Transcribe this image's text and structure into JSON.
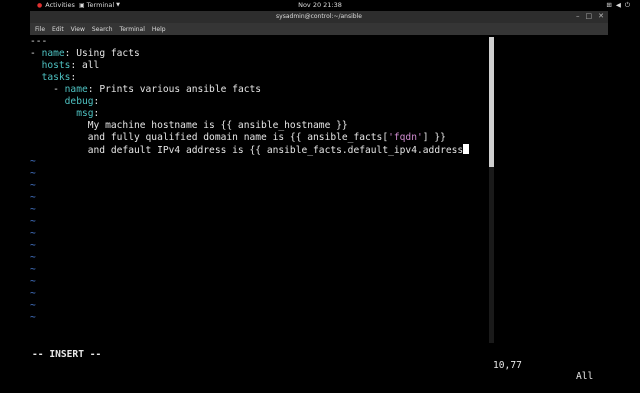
{
  "topbar": {
    "activities": "Activities",
    "app_menu": "Terminal",
    "clock": "Nov 20  21:38"
  },
  "window": {
    "title": "sysadmin@control:~/ansible"
  },
  "menubar": [
    "File",
    "Edit",
    "View",
    "Search",
    "Terminal",
    "Help"
  ],
  "editor": {
    "lines": [
      [
        {
          "t": "---",
          "c": "c"
        }
      ],
      [
        {
          "t": "- ",
          "c": "c"
        },
        {
          "t": "name",
          "c": "k"
        },
        {
          "t": ": Using facts",
          "c": "c"
        }
      ],
      [
        {
          "t": "  ",
          "c": "c"
        },
        {
          "t": "hosts",
          "c": "k"
        },
        {
          "t": ": all",
          "c": "c"
        }
      ],
      [
        {
          "t": "  ",
          "c": "c"
        },
        {
          "t": "tasks",
          "c": "k"
        },
        {
          "t": ":",
          "c": "c"
        }
      ],
      [
        {
          "t": "    - ",
          "c": "c"
        },
        {
          "t": "name",
          "c": "k"
        },
        {
          "t": ": Prints various ansible facts",
          "c": "c"
        }
      ],
      [
        {
          "t": "      ",
          "c": "c"
        },
        {
          "t": "debug",
          "c": "k"
        },
        {
          "t": ":",
          "c": "c"
        }
      ],
      [
        {
          "t": "        ",
          "c": "c"
        },
        {
          "t": "msg",
          "c": "k"
        },
        {
          "t": ":",
          "c": "c"
        }
      ],
      [
        {
          "t": "          My machine hostname is {{ ansible_hostname }}",
          "c": "c"
        }
      ],
      [
        {
          "t": "          and fully qualified domain name is {{ ansible_facts[",
          "c": "c"
        },
        {
          "t": "'fqdn'",
          "c": "s"
        },
        {
          "t": "] }}",
          "c": "c"
        }
      ],
      [
        {
          "t": "          and default IPv4 address is {{ ansible_facts.default_ipv4.address",
          "c": "c"
        },
        {
          "t": "",
          "c": "cursor"
        }
      ]
    ],
    "tilde": "~",
    "tilde_count": 14
  },
  "status": {
    "mode": "-- INSERT --",
    "position": "10,77",
    "percent": "All"
  }
}
